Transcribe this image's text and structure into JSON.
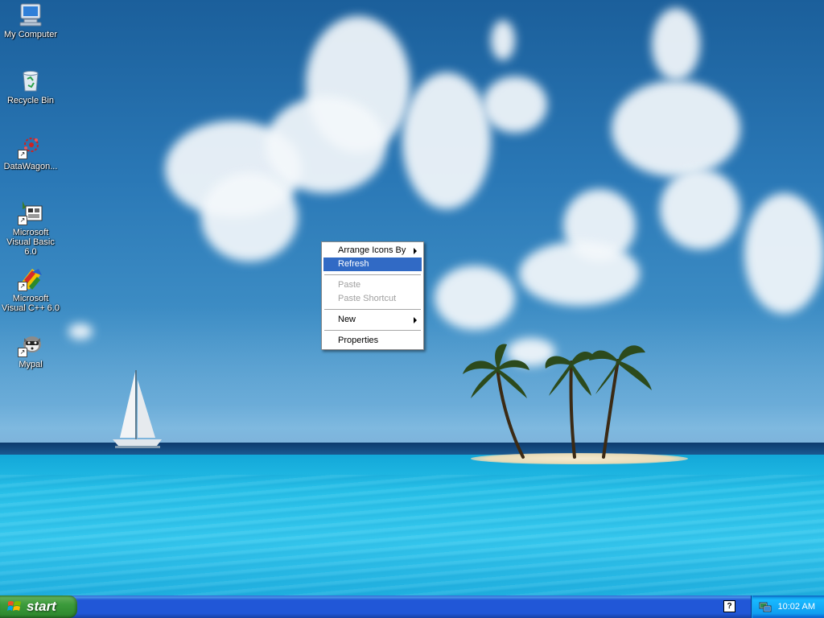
{
  "desktop": {
    "icons": [
      {
        "label": "My Computer",
        "icon": "my-computer-icon"
      },
      {
        "label": "Recycle Bin",
        "icon": "recycle-bin-icon"
      },
      {
        "label": "DataWagon...",
        "icon": "datawagon-icon"
      },
      {
        "label": "Microsoft Visual Basic 6.0",
        "icon": "visual-basic-icon"
      },
      {
        "label": "Microsoft Visual C++ 6.0",
        "icon": "visual-cpp-icon"
      },
      {
        "label": "Mypal",
        "icon": "mypal-browser-icon"
      }
    ]
  },
  "context_menu": {
    "items": [
      {
        "label": "Arrange Icons By",
        "submenu": true,
        "state": "normal"
      },
      {
        "label": "Refresh",
        "submenu": false,
        "state": "highlighted"
      },
      {
        "label": "Paste",
        "submenu": false,
        "state": "disabled"
      },
      {
        "label": "Paste Shortcut",
        "submenu": false,
        "state": "disabled"
      },
      {
        "label": "New",
        "submenu": true,
        "state": "normal"
      },
      {
        "label": "Properties",
        "submenu": false,
        "state": "normal"
      }
    ]
  },
  "taskbar": {
    "start_label": "start",
    "help_glyph": "?",
    "clock": "10:02 AM"
  },
  "colors": {
    "menu_highlight": "#316ac5",
    "taskbar_blue": "#2157d7",
    "start_green": "#3b9b3b",
    "tray_blue": "#0f9ef0"
  }
}
